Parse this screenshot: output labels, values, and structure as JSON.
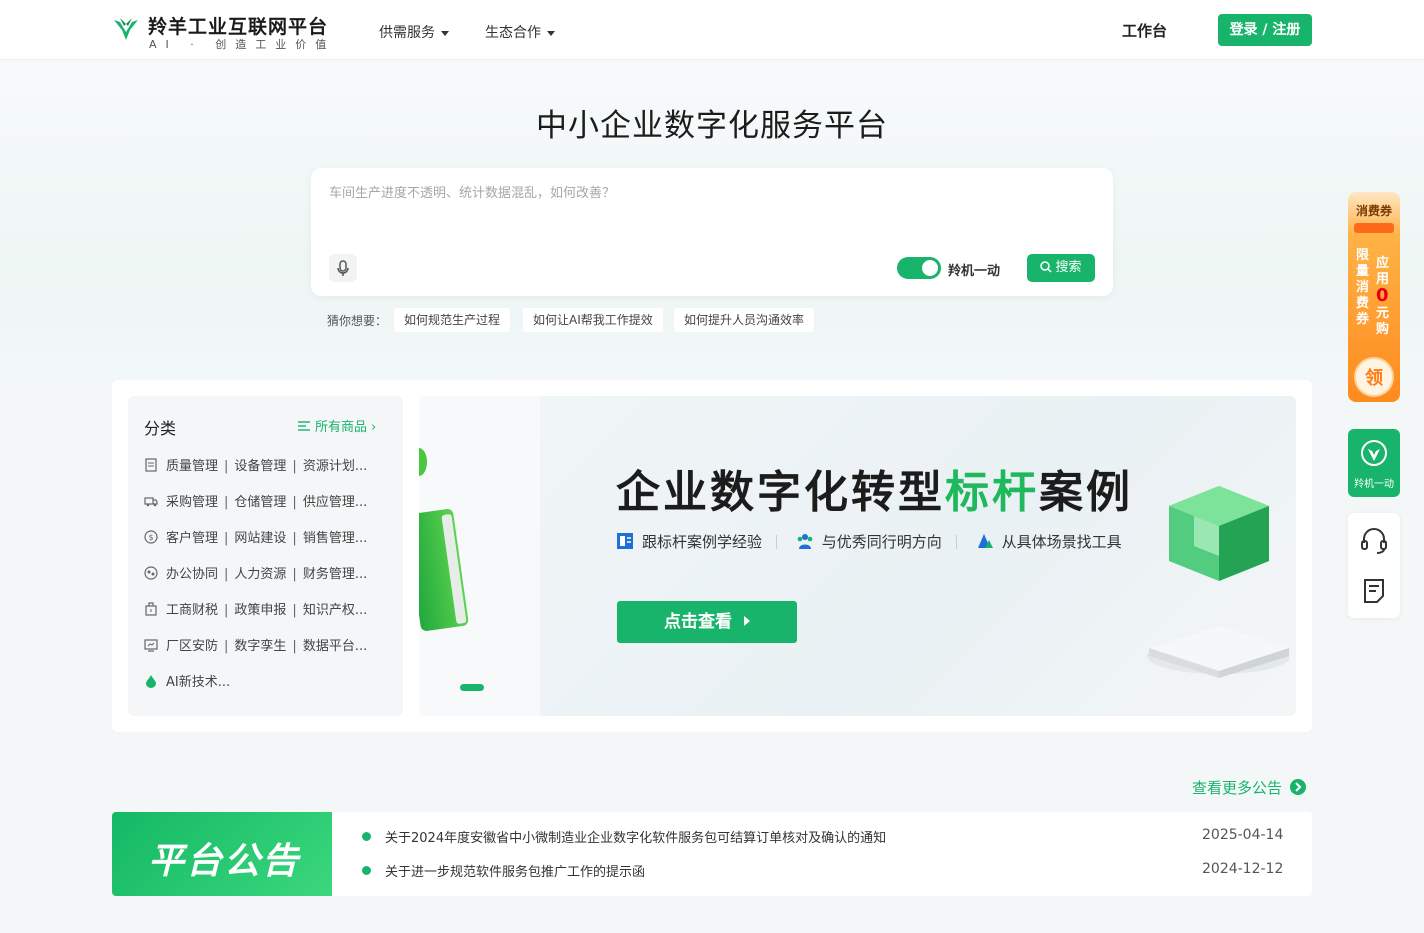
{
  "header": {
    "brand_title": "羚羊工业互联网平台",
    "brand_sub": "AI · 创造工业价值",
    "nav": [
      {
        "label": "供需服务"
      },
      {
        "label": "生态合作"
      }
    ],
    "workbench": "工作台",
    "login": "登录 / 注册",
    "accent": "#19b46b"
  },
  "hero": {
    "title": "中小企业数字化服务平台",
    "search_placeholder": "车间生产进度不透明、统计数据混乱，如何改善？",
    "toggle_label": "羚机一动",
    "toggle_on": true,
    "search_button": "搜索",
    "guess_label": "猜你想要：",
    "suggestions": [
      "如何规范生产过程",
      "如何让AI帮我工作提效",
      "如何提升人员沟通效率"
    ]
  },
  "categories": {
    "title": "分类",
    "all_link": "所有商品",
    "rows": [
      {
        "icon": "document-icon",
        "items": [
          "质量管理",
          "设备管理",
          "资源计划..."
        ]
      },
      {
        "icon": "truck-icon",
        "items": [
          "采购管理",
          "仓储管理",
          "供应管理..."
        ]
      },
      {
        "icon": "dollar-icon",
        "items": [
          "客户管理",
          "网站建设",
          "销售管理..."
        ]
      },
      {
        "icon": "collaboration-icon",
        "items": [
          "办公协同",
          "人力资源",
          "财务管理..."
        ]
      },
      {
        "icon": "building-icon",
        "items": [
          "工商财税",
          "政策申报",
          "知识产权..."
        ]
      },
      {
        "icon": "monitor-icon",
        "items": [
          "厂区安防",
          "数字孪生",
          "数据平台..."
        ]
      },
      {
        "icon": "ai-drop-icon",
        "items": [
          "AI新技术..."
        ]
      }
    ]
  },
  "banner": {
    "title_a": "企业数字化转型",
    "title_hl": "标杆",
    "title_b": "案例",
    "features": [
      "跟标杆案例学经验",
      "与优秀同行明方向",
      "从具体场景找工具"
    ],
    "cta": "点击查看"
  },
  "side": {
    "coupon_title": "消费券",
    "coupon_col1": "限量消费券",
    "coupon_col2_a": "应用",
    "coupon_zero": "0",
    "coupon_col2_b": "元购",
    "coupon_get": "领",
    "ai_label": "羚机一动"
  },
  "notices": {
    "more": "查看更多公告",
    "tag": "平台公告",
    "items": [
      {
        "text": "关于2024年度安徽省中小微制造业企业数字化软件服务包可结算订单核对及确认的通知",
        "date": "2025-04-14"
      },
      {
        "text": "关于进一步规范软件服务包推广工作的提示函",
        "date": "2024-12-12"
      }
    ]
  }
}
